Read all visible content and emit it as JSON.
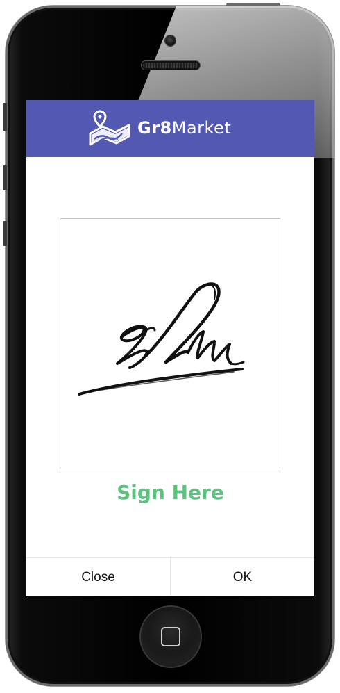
{
  "device": {
    "model": "smartphone"
  },
  "header": {
    "brand_bold": "Gr8",
    "brand_regular": "Market",
    "logo_icon": "map-pin-icon",
    "background": "#5358b3"
  },
  "signature_pad": {
    "has_signature": true,
    "border_color": "#c8c8c8"
  },
  "prompt": {
    "label": "Sign Here",
    "color": "#5ac47d"
  },
  "footer": {
    "close_label": "Close",
    "ok_label": "OK"
  }
}
